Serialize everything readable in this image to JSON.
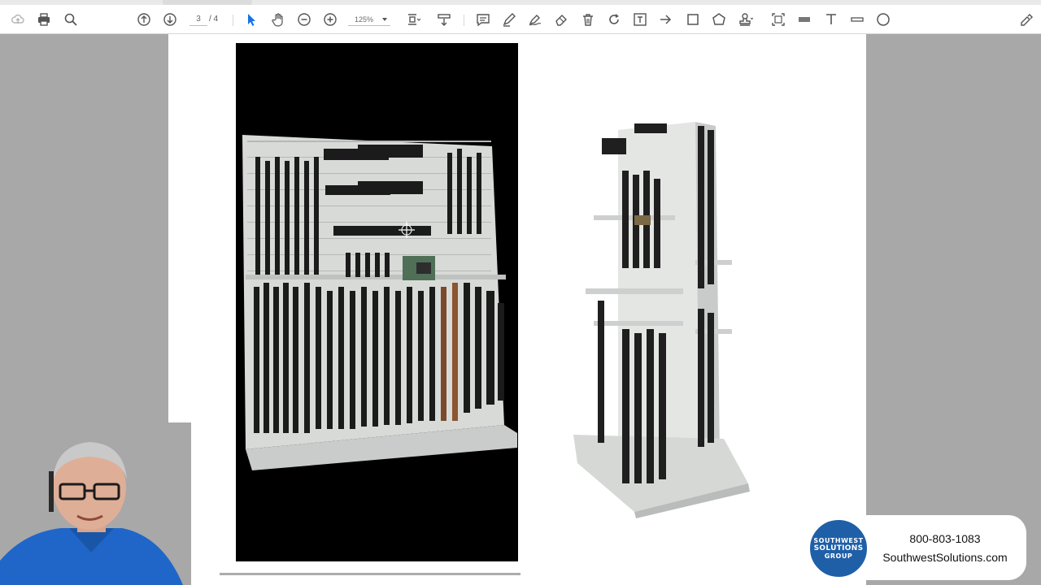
{
  "toolbar": {
    "page_current": "3",
    "page_total": "/ 4",
    "zoom": "125%",
    "active_tool": "select-pointer",
    "accent_color": "#1473e6"
  },
  "document": {
    "images": [
      "gun-wall-rack-photo",
      "rotating-gun-tower-photo"
    ]
  },
  "overlay": {
    "logo_line1": "SOUTHWEST",
    "logo_line2": "SOLUTIONS",
    "logo_line3": "GROUP",
    "phone": "800-803-1083",
    "website": "SouthwestSolutions.com",
    "brand_color": "#1f5fa8"
  }
}
